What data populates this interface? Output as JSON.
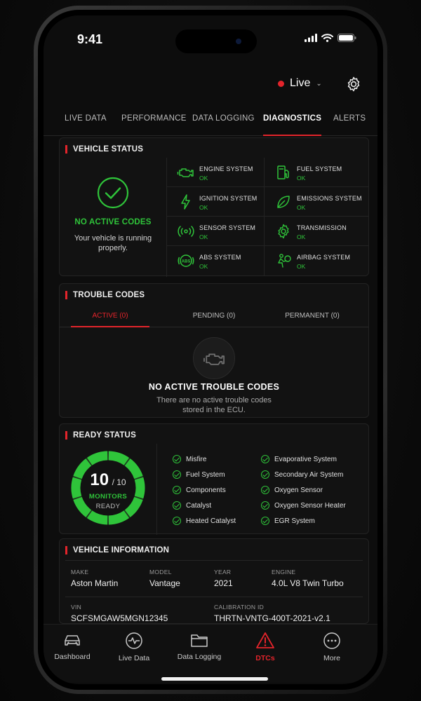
{
  "status_bar": {
    "time": "9:41"
  },
  "top_bar": {
    "live_label": "Live"
  },
  "tabs": [
    {
      "label": "LIVE DATA"
    },
    {
      "label": "PERFORMANCE"
    },
    {
      "label": "DATA LOGGING"
    },
    {
      "label": "DIAGNOSTICS",
      "active": true
    },
    {
      "label": "ALERTS"
    }
  ],
  "vehicle_status": {
    "title": "VEHICLE STATUS",
    "summary_title": "NO ACTIVE CODES",
    "summary_desc": "Your vehicle is running properly.",
    "systems": [
      {
        "name": "ENGINE SYSTEM",
        "status": "OK",
        "icon": "engine-icon"
      },
      {
        "name": "FUEL SYSTEM",
        "status": "OK",
        "icon": "fuel-pump-icon"
      },
      {
        "name": "IGNITION SYSTEM",
        "status": "OK",
        "icon": "lightning-icon"
      },
      {
        "name": "EMISSIONS SYSTEM",
        "status": "OK",
        "icon": "leaf-icon"
      },
      {
        "name": "SENSOR SYSTEM",
        "status": "OK",
        "icon": "sensor-wave-icon"
      },
      {
        "name": "TRANSMISSION",
        "status": "OK",
        "icon": "gear-icon"
      },
      {
        "name": "ABS SYSTEM",
        "status": "OK",
        "icon": "abs-icon"
      },
      {
        "name": "AIRBAG SYSTEM",
        "status": "OK",
        "icon": "airbag-icon"
      }
    ]
  },
  "trouble_codes": {
    "title": "TROUBLE CODES",
    "tabs": [
      {
        "label": "ACTIVE (0)",
        "active": true
      },
      {
        "label": "PENDING (0)"
      },
      {
        "label": "PERMANENT (0)"
      }
    ],
    "empty_title": "NO ACTIVE TROUBLE CODES",
    "empty_desc_line1": "There are no active trouble codes",
    "empty_desc_line2": "stored in the ECU."
  },
  "ready_status": {
    "title": "READY STATUS",
    "ready_count": "10",
    "total": "/ 10",
    "label1": "MONITORS",
    "label2": "READY",
    "progress": 1.0,
    "monitors": [
      "Misfire",
      "Evaporative System",
      "Fuel System",
      "Secondary Air System",
      "Components",
      "Oxygen Sensor",
      "Catalyst",
      "Oxygen Sensor Heater",
      "Heated Catalyst",
      "EGR System"
    ]
  },
  "vehicle_info": {
    "title": "VEHICLE INFORMATION",
    "make_label": "MAKE",
    "make": "Aston Martin",
    "model_label": "MODEL",
    "model": "Vantage",
    "year_label": "YEAR",
    "year": "2021",
    "engine_label": "ENGINE",
    "engine": "4.0L V8 Twin Turbo",
    "vin_label": "VIN",
    "vin": "SCFSMGAW5MGN12345",
    "calibration_label": "CALIBRATION ID",
    "calibration": "THRTN-VNTG-400T-2021-v2.1"
  },
  "bottom_nav": [
    {
      "label": "Dashboard",
      "icon": "car-icon"
    },
    {
      "label": "Live Data",
      "icon": "pulse-icon"
    },
    {
      "label": "Data Logging",
      "icon": "folder-icon"
    },
    {
      "label": "DTCs",
      "icon": "warning-triangle-icon",
      "active": true
    },
    {
      "label": "More",
      "icon": "more-icon"
    }
  ],
  "colors": {
    "accent": "#e3242b",
    "ok": "#2fc43a",
    "background": "#0d0d0d",
    "card": "#121212"
  }
}
